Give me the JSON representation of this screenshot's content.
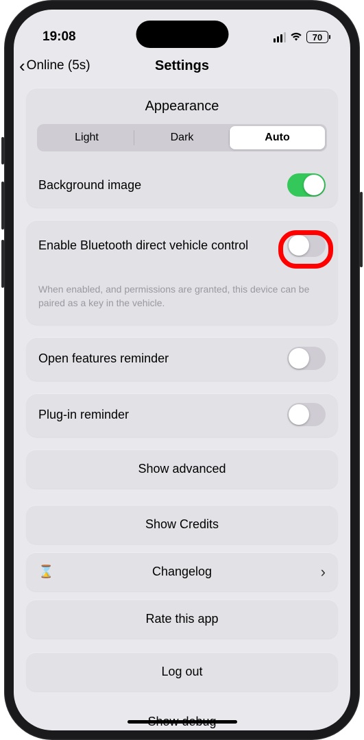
{
  "status": {
    "time": "19:08",
    "battery": "70"
  },
  "nav": {
    "back_label": "Online (5s)",
    "title": "Settings"
  },
  "appearance": {
    "header": "Appearance",
    "segments": {
      "light": "Light",
      "dark": "Dark",
      "auto": "Auto"
    },
    "active_segment": "auto",
    "background_image_label": "Background image",
    "background_image_on": true
  },
  "bluetooth": {
    "label": "Enable Bluetooth direct vehicle control",
    "on": false,
    "helper": "When enabled, and permissions are granted, this device can be paired as a key in the vehicle."
  },
  "reminders": {
    "open_features_label": "Open features reminder",
    "open_features_on": false,
    "plugin_label": "Plug-in reminder",
    "plugin_on": false
  },
  "buttons": {
    "show_advanced": "Show advanced",
    "show_credits": "Show Credits",
    "changelog": "Changelog",
    "rate": "Rate this app",
    "logout": "Log out",
    "show_debug": "Show debug"
  }
}
